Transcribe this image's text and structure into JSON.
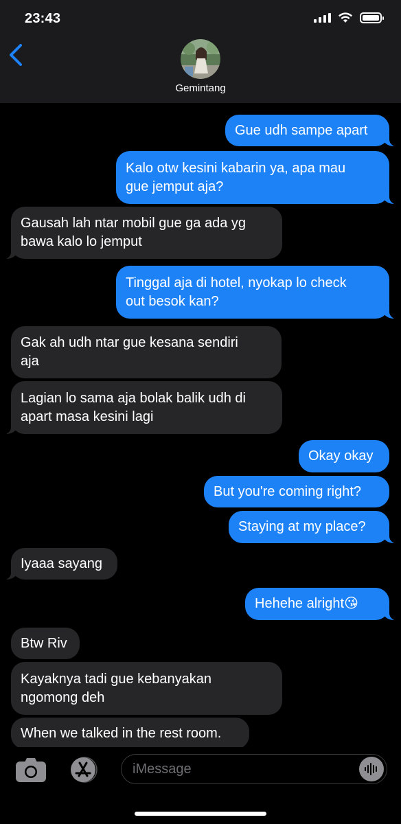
{
  "status_bar": {
    "time": "23:43"
  },
  "header": {
    "contact_name": "Gemintang"
  },
  "messages": [
    {
      "dir": "out",
      "lines": [
        "Gue udh sampe apart"
      ]
    },
    {
      "dir": "out",
      "lines": [
        "Kalo otw kesini kabarin ya, apa mau",
        "gue jemput aja?"
      ]
    },
    {
      "dir": "in",
      "lines": [
        "Gausah lah ntar mobil gue ga ada yg",
        "bawa kalo lo jemput"
      ]
    },
    {
      "dir": "out",
      "lines": [
        "Tinggal aja di hotel, nyokap lo check",
        "out besok kan?"
      ]
    },
    {
      "dir": "in",
      "lines": [
        "Gak ah udh ntar gue kesana sendiri",
        "aja"
      ]
    },
    {
      "dir": "in",
      "lines": [
        "Lagian lo sama aja bolak balik udh di",
        "apart masa kesini lagi"
      ]
    },
    {
      "dir": "out",
      "lines": [
        "Okay okay"
      ]
    },
    {
      "dir": "out",
      "lines": [
        "But you're coming right?"
      ]
    },
    {
      "dir": "out",
      "lines": [
        "Staying at my place?"
      ]
    },
    {
      "dir": "in",
      "lines": [
        "Iyaaa sayang"
      ]
    },
    {
      "dir": "out",
      "lines": [
        "Hehehe alright😘"
      ]
    },
    {
      "dir": "in",
      "lines": [
        "Btw Riv"
      ]
    },
    {
      "dir": "in",
      "lines": [
        "Kayaknya tadi gue kebanyakan",
        "ngomong deh"
      ]
    },
    {
      "dir": "in",
      "lines": [
        "When we talked in the rest room."
      ]
    }
  ],
  "input_bar": {
    "placeholder": "iMessage"
  },
  "colors": {
    "outgoing": "#1e82f7",
    "incoming": "#262628",
    "header": "#1b1b1d"
  },
  "icons": [
    "back-chevron-icon",
    "camera-icon",
    "app-store-icon",
    "audio-waveform-icon",
    "signal-icon",
    "wifi-icon",
    "battery-icon"
  ]
}
